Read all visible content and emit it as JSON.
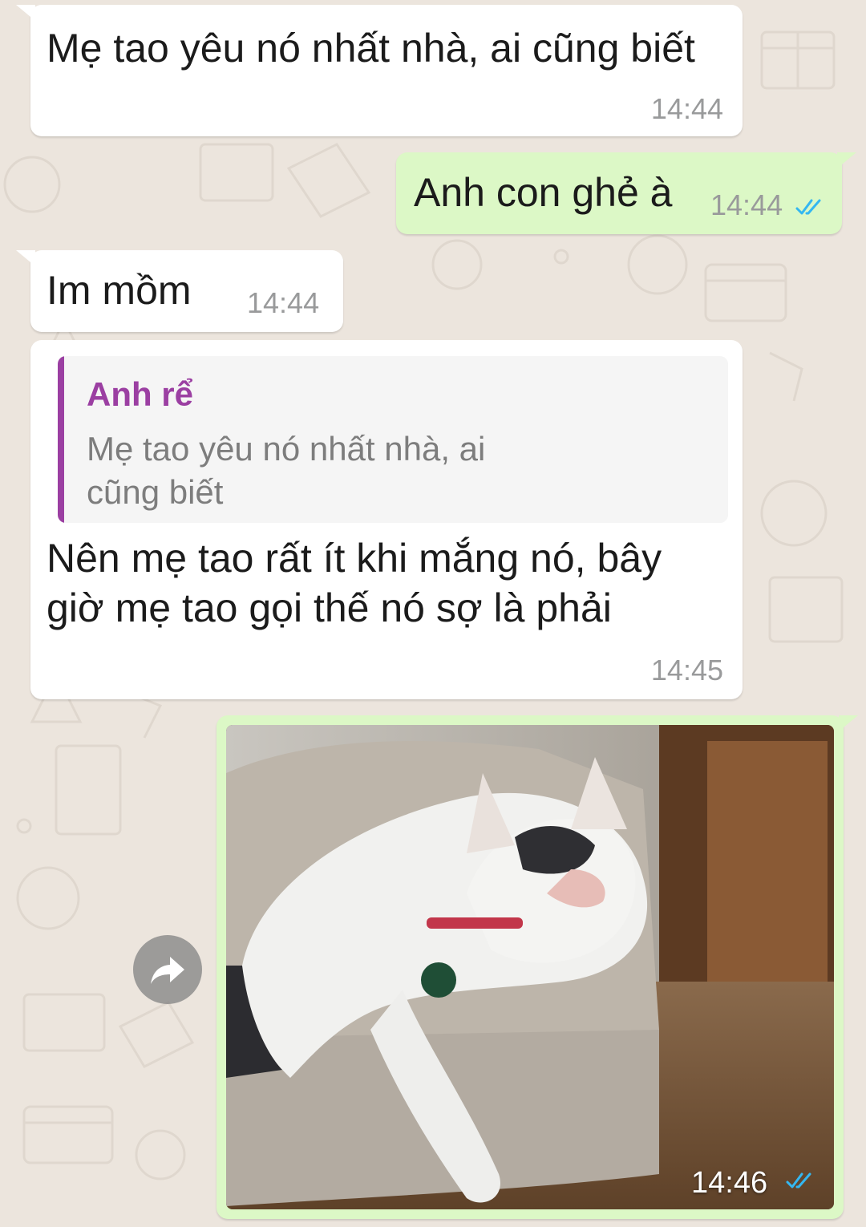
{
  "messages": [
    {
      "direction": "incoming",
      "text": "Mẹ tao yêu nó nhất nhà, ai cũng biết",
      "time": "14:44"
    },
    {
      "direction": "outgoing",
      "text": "Anh con ghẻ à",
      "time": "14:44",
      "status": "read"
    },
    {
      "direction": "incoming",
      "text": "Im mồm",
      "time": "14:44"
    },
    {
      "direction": "incoming",
      "reply_to": {
        "author": "Anh rể",
        "line1": "Mẹ tao yêu nó nhất nhà, ai",
        "line2": "cũng biết"
      },
      "line1": "Nên mẹ tao rất ít khi mắng nó, bây",
      "line2": "giờ mẹ tao gọi thế nó sợ là phải",
      "time": "14:45"
    },
    {
      "direction": "outgoing",
      "type": "image",
      "image_icon": "cat-photo",
      "time": "14:46",
      "status": "read"
    }
  ],
  "icons": {
    "forward": "forward-arrow-icon",
    "read_receipt": "double-check-icon"
  },
  "colors": {
    "background": "#ece5dd",
    "incoming_bubble": "#ffffff",
    "outgoing_bubble": "#dcf8c6",
    "quote_accent": "#9b3fa2",
    "read_tick": "#34b7f1",
    "timestamp": "#999a9b"
  }
}
